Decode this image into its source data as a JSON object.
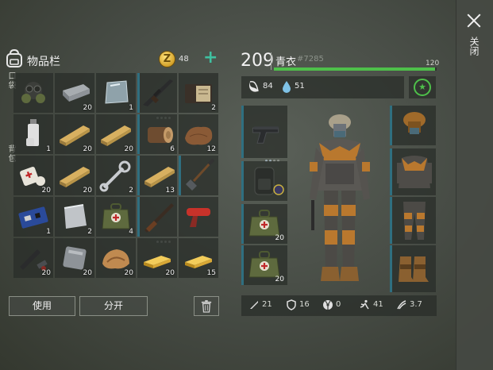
{
  "close": {
    "label": "关闭"
  },
  "inventory": {
    "title": "物品栏",
    "coins": "48",
    "add_symbol": "+",
    "coin_symbol": "Z",
    "pocket_label": "口袋",
    "backpack_label": "背包"
  },
  "items": [
    {
      "name": "gas-mask",
      "qty": ""
    },
    {
      "name": "metal-ingot",
      "qty": "20"
    },
    {
      "name": "glass-pane",
      "qty": "1"
    },
    {
      "name": "assault-rifle",
      "qty": ""
    },
    {
      "name": "notebook",
      "qty": "2"
    },
    {
      "name": "spray-bottle",
      "qty": "1"
    },
    {
      "name": "wooden-plank",
      "qty": "20"
    },
    {
      "name": "wooden-plank",
      "qty": "20"
    },
    {
      "name": "log",
      "qty": "6"
    },
    {
      "name": "leather",
      "qty": "12"
    },
    {
      "name": "bandage",
      "qty": "20"
    },
    {
      "name": "wooden-plank",
      "qty": "20"
    },
    {
      "name": "wrench",
      "qty": "2"
    },
    {
      "name": "wooden-plank",
      "qty": "13"
    },
    {
      "name": "shovel",
      "qty": ""
    },
    {
      "name": "circuit-board",
      "qty": "1"
    },
    {
      "name": "metal-sheet",
      "qty": "2"
    },
    {
      "name": "medkit-bag",
      "qty": "4"
    },
    {
      "name": "shotgun",
      "qty": ""
    },
    {
      "name": "flare-gun",
      "qty": ""
    },
    {
      "name": "pistol-parts",
      "qty": "20"
    },
    {
      "name": "metal-plate",
      "qty": "20"
    },
    {
      "name": "cloth-pile",
      "qty": "20"
    },
    {
      "name": "gold-bar",
      "qty": "20"
    },
    {
      "name": "gold-bar",
      "qty": "15"
    }
  ],
  "buttons": {
    "use": "使用",
    "split": "分开"
  },
  "character": {
    "level": "209",
    "name": "青衣",
    "id": "#7285",
    "xp_max": "120",
    "xp_fraction": 0.99,
    "hunger": "84",
    "thirst": "51",
    "fav_symbol": "★"
  },
  "equipment": {
    "weapon_qty": "",
    "backpack_qty": "",
    "medkit1_qty": "20",
    "medkit2_qty": "20"
  },
  "stats": {
    "damage": "21",
    "armor": "16",
    "radiation": "0",
    "speed": "41",
    "stealth": "3.7"
  },
  "colors": {
    "accent_green": "#4ec04a",
    "slot_marker": "#2f6f80",
    "teal_plus": "#3fc0a0"
  }
}
